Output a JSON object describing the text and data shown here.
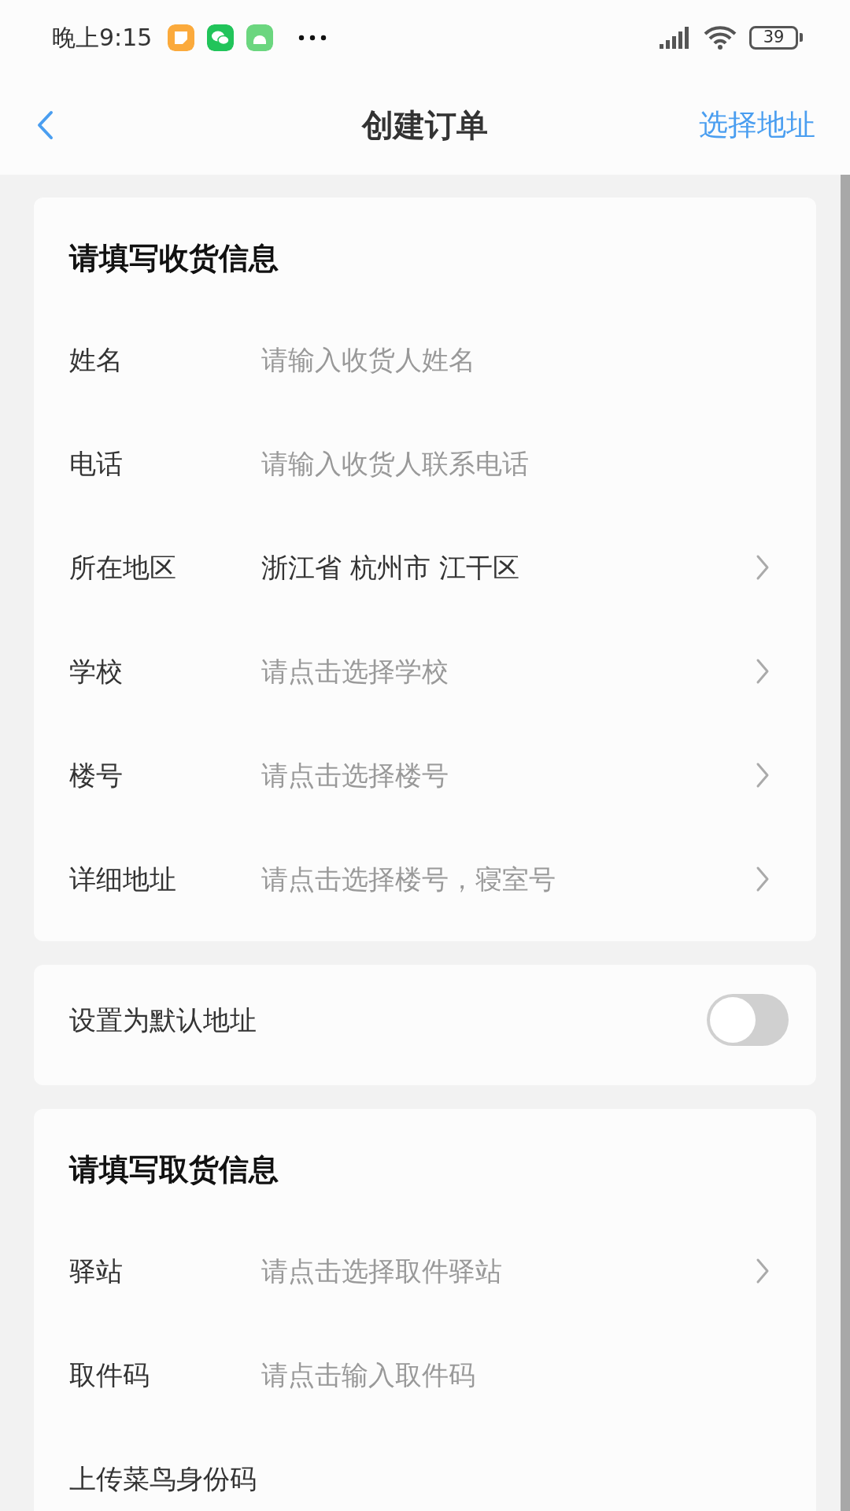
{
  "status_bar": {
    "time": "晚上9:15",
    "battery": "39"
  },
  "nav": {
    "title": "创建订单",
    "action": "选择地址"
  },
  "cards": [
    {
      "kind": "form",
      "title": "请填写收货信息",
      "rows": [
        {
          "label": "姓名",
          "placeholder": "请输入收货人姓名",
          "kind": "input"
        },
        {
          "label": "电话",
          "placeholder": "请输入收货人联系电话",
          "kind": "input"
        },
        {
          "label": "所在地区",
          "value": "浙江省 杭州市 江干区",
          "kind": "select"
        },
        {
          "label": "学校",
          "placeholder": "请点击选择学校",
          "kind": "select"
        },
        {
          "label": "楼号",
          "placeholder": "请点击选择楼号",
          "kind": "select"
        },
        {
          "label": "详细地址",
          "placeholder": "请点击选择楼号，寝室号",
          "kind": "select"
        }
      ]
    },
    {
      "kind": "switch",
      "label": "设置为默认地址",
      "on": false
    },
    {
      "kind": "form",
      "title": "请填写取货信息",
      "rows": [
        {
          "label": "驿站",
          "placeholder": "请点击选择取件驿站",
          "kind": "select"
        },
        {
          "label": "取件码",
          "placeholder": "请点击输入取件码",
          "kind": "input"
        },
        {
          "label": "上传菜鸟身份码",
          "kind": "plain"
        }
      ]
    }
  ]
}
